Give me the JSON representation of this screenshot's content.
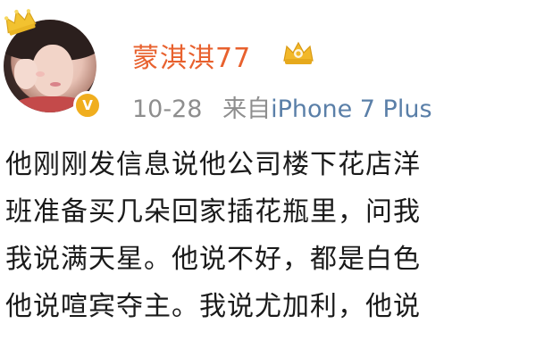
{
  "post": {
    "author": {
      "name": "蒙淇淇77",
      "verified_mark": "V"
    },
    "meta": {
      "date": "10-28",
      "source_prefix": "来自",
      "device": "iPhone 7 Plus"
    },
    "text_lines": [
      "他刚刚发信息说他公司楼下花店洋",
      "班准备买几朵回家插花瓶里，问我",
      "我说满天星。他说不好，都是白色",
      "他说喧宾夺主。我说尤加利，他说"
    ]
  },
  "colors": {
    "username": "#e8612e",
    "meta_gray": "#8e8e8e",
    "device_blue": "#5a7fa8",
    "verified_gold": "#f0ae1e",
    "crown_gold": "#f2c230",
    "text": "#1a1a1a"
  },
  "icons": {
    "crown": "crown-icon",
    "verified": "verified-badge-icon",
    "member": "member-badge-icon"
  }
}
